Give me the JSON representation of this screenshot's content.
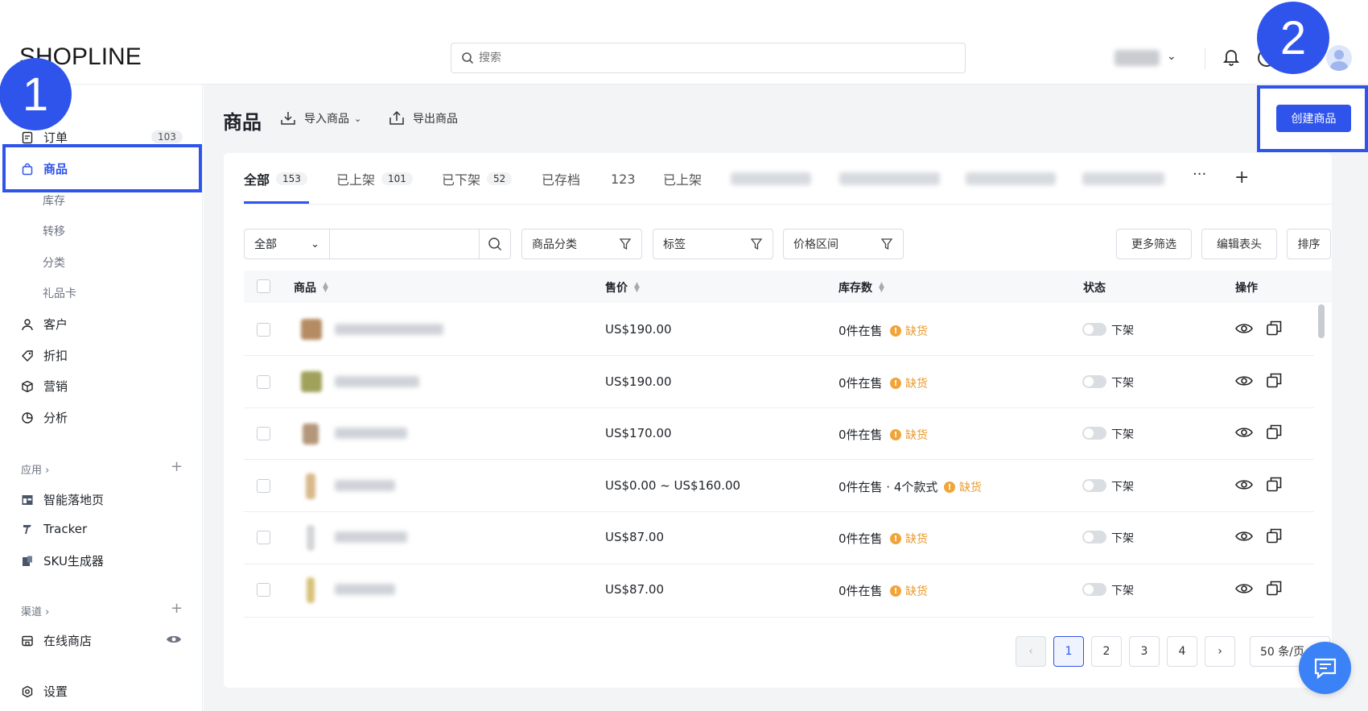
{
  "header": {
    "logo_text": "SHOPLINE",
    "search_placeholder": "搜索"
  },
  "sidebar": {
    "orders": {
      "label": "订单",
      "count": "103"
    },
    "products": {
      "label": "商品"
    },
    "sub_items": [
      "库存",
      "转移",
      "分类",
      "礼品卡"
    ],
    "customers": "客户",
    "discounts": "折扣",
    "marketing": "营销",
    "analytics": "分析",
    "apps_label": "应用 ›",
    "apps": [
      "智能落地页",
      "Tracker",
      "SKU生成器"
    ],
    "channels_label": "渠道 ›",
    "online_store": "在线商店",
    "settings": "设置"
  },
  "page": {
    "title": "商品",
    "import_label": "导入商品",
    "export_label": "导出商品",
    "create_label": "创建商品"
  },
  "tabs": [
    {
      "label": "全部",
      "count": "153"
    },
    {
      "label": "已上架",
      "count": "101"
    },
    {
      "label": "已下架",
      "count": "52"
    },
    {
      "label": "已存档"
    },
    {
      "label": "123"
    },
    {
      "label": "已上架"
    }
  ],
  "filters": {
    "scope": "全部",
    "category": "商品分类",
    "tags": "标签",
    "price": "价格区间",
    "more": "更多筛选",
    "edit_columns": "编辑表头",
    "sort": "排序"
  },
  "table": {
    "headers": [
      "商品",
      "售价",
      "库存数",
      "状态",
      "操作"
    ],
    "rows": [
      {
        "price": "US$190.00",
        "stock": "0件在售",
        "warn": "缺货",
        "status": "下架"
      },
      {
        "price": "US$190.00",
        "stock": "0件在售",
        "warn": "缺货",
        "status": "下架"
      },
      {
        "price": "US$170.00",
        "stock": "0件在售",
        "warn": "缺货",
        "status": "下架"
      },
      {
        "price": "US$0.00 ~ US$160.00",
        "stock": "0件在售 · 4个款式",
        "warn": "缺货",
        "status": "下架"
      },
      {
        "price": "US$87.00",
        "stock": "0件在售",
        "warn": "缺货",
        "status": "下架"
      },
      {
        "price": "US$87.00",
        "stock": "0件在售",
        "warn": "缺货",
        "status": "下架"
      }
    ]
  },
  "pagination": {
    "pages": [
      "1",
      "2",
      "3",
      "4"
    ],
    "current": "1",
    "per_page": "50 条/页"
  },
  "callouts": [
    "1",
    "2"
  ],
  "colors": {
    "accent": "#2f54eb",
    "warning": "#f0a43a"
  }
}
